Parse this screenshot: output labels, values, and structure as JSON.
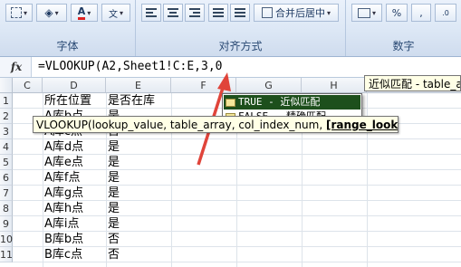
{
  "ribbon": {
    "groups": [
      {
        "label": "字体"
      },
      {
        "label": "对齐方式"
      },
      {
        "label": "数字"
      }
    ],
    "merge_center_label": "合并后居中",
    "percent_label": "%",
    "comma_label": ","
  },
  "formula_bar": {
    "fx_label": "fx",
    "formula": "=VLOOKUP(A2,Sheet1!C:E,3,0"
  },
  "columns": [
    "C",
    "D",
    "E",
    "F",
    "G",
    "H"
  ],
  "rows": [
    {
      "num": "1",
      "d": "所在位置",
      "e": "是否在库"
    },
    {
      "num": "2",
      "d": "A库b点",
      "e": "是"
    },
    {
      "num": "3",
      "d": "A库c点",
      "e": "否"
    },
    {
      "num": "4",
      "d": "A库d点",
      "e": "是"
    },
    {
      "num": "5",
      "d": "A库e点",
      "e": "是"
    },
    {
      "num": "6",
      "d": "A库f点",
      "e": "是"
    },
    {
      "num": "7",
      "d": "A库g点",
      "e": "是"
    },
    {
      "num": "8",
      "d": "A库h点",
      "e": "是"
    },
    {
      "num": "9",
      "d": "A库i点",
      "e": "是"
    },
    {
      "num": "10",
      "d": "B库b点",
      "e": "否"
    },
    {
      "num": "11",
      "d": "B库c点",
      "e": "否"
    }
  ],
  "tooltip": {
    "text": "VLOOKUP(lookup_value, table_array, col_index_num, ",
    "bold": "[range_lookup]",
    "end": ")"
  },
  "autocomplete": {
    "items": [
      {
        "label": "TRUE - 近似匹配",
        "selected": true
      },
      {
        "label": "FALSE - 精确匹配",
        "selected": false
      }
    ]
  },
  "hint": "近似匹配 - table_a",
  "colors": {
    "arrow": "#e0443a",
    "selected": "#1d4f1c"
  }
}
